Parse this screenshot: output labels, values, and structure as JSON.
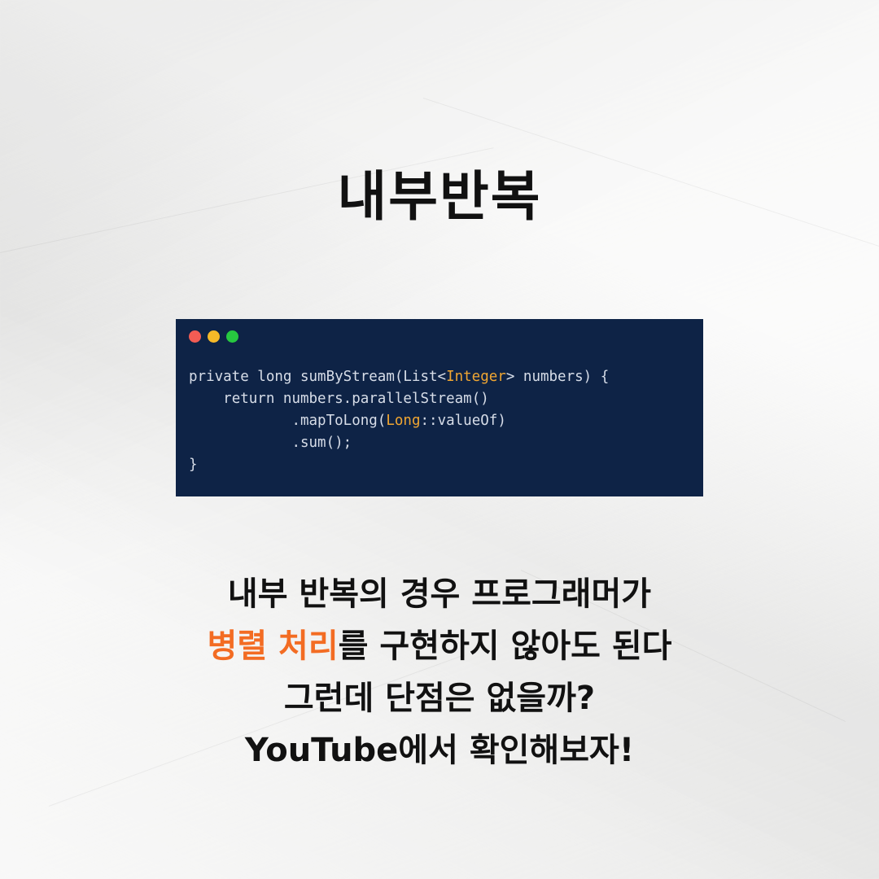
{
  "title": "내부반복",
  "code_window": {
    "controls": [
      "red-dot",
      "yellow-dot",
      "green-dot"
    ],
    "lines": [
      {
        "indent": "",
        "parts": [
          {
            "text": "private long sumByStream(List<",
            "kind": "plain"
          },
          {
            "text": "Integer",
            "kind": "type"
          },
          {
            "text": "> numbers) {",
            "kind": "plain"
          }
        ]
      },
      {
        "indent": "    ",
        "parts": [
          {
            "text": "return numbers.parallelStream()",
            "kind": "plain"
          }
        ]
      },
      {
        "indent": "            ",
        "parts": [
          {
            "text": ".mapToLong(",
            "kind": "plain"
          },
          {
            "text": "Long",
            "kind": "type"
          },
          {
            "text": "::valueOf)",
            "kind": "plain"
          }
        ]
      },
      {
        "indent": "            ",
        "parts": [
          {
            "text": ".sum();",
            "kind": "plain"
          }
        ]
      },
      {
        "indent": "",
        "parts": [
          {
            "text": "}",
            "kind": "plain"
          }
        ]
      }
    ],
    "colors": {
      "background": "#0e2346",
      "text": "#d7dde8",
      "type": "#f0a632"
    }
  },
  "body": {
    "line1": "내부 반복의 경우 프로그래머가",
    "line2_highlight": "병렬 처리",
    "line2_rest": "를 구현하지 않아도 된다",
    "line3": "그런데 단점은 없을까?",
    "line4": "YouTube에서 확인해보자!",
    "highlight_color": "#f36c23"
  }
}
